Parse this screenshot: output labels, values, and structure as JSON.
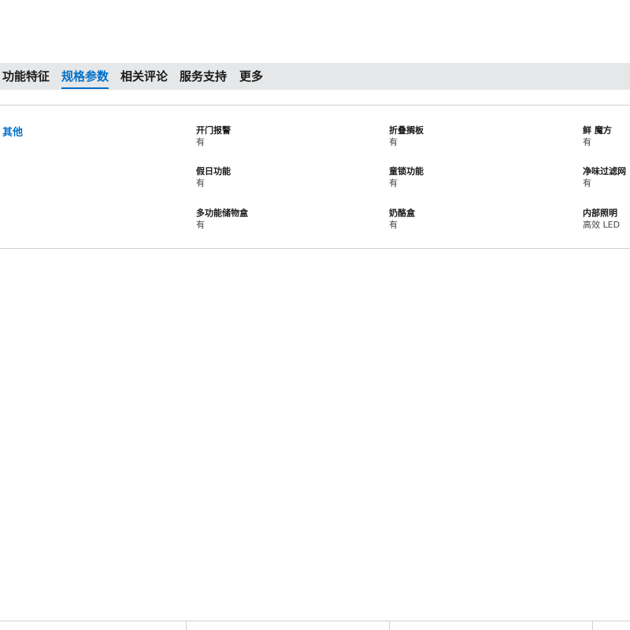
{
  "tabs": [
    {
      "label": "功能特征",
      "active": false
    },
    {
      "label": "规格参数",
      "active": true
    },
    {
      "label": "相关评论",
      "active": false
    },
    {
      "label": "服务支持",
      "active": false
    },
    {
      "label": "更多",
      "active": false
    }
  ],
  "specs_section": {
    "title": "其他",
    "rows": [
      [
        {
          "label": "开门报警",
          "value": "有"
        },
        {
          "label": "折叠搁板",
          "value": "有"
        },
        {
          "label": "鲜 魔方",
          "value": "有"
        }
      ],
      [
        {
          "label": "假日功能",
          "value": "有"
        },
        {
          "label": "童锁功能",
          "value": "有"
        },
        {
          "label": "净味过滤网",
          "value": "有"
        }
      ],
      [
        {
          "label": "多功能储物盒",
          "value": "有"
        },
        {
          "label": "奶酪盒",
          "value": "有"
        },
        {
          "label": "内部照明",
          "value": "高效 LED"
        }
      ]
    ]
  },
  "colors": {
    "accent": "#0070c9",
    "tab_bar_bg": "#e6e7e8",
    "divider": "#d2d2d7"
  }
}
